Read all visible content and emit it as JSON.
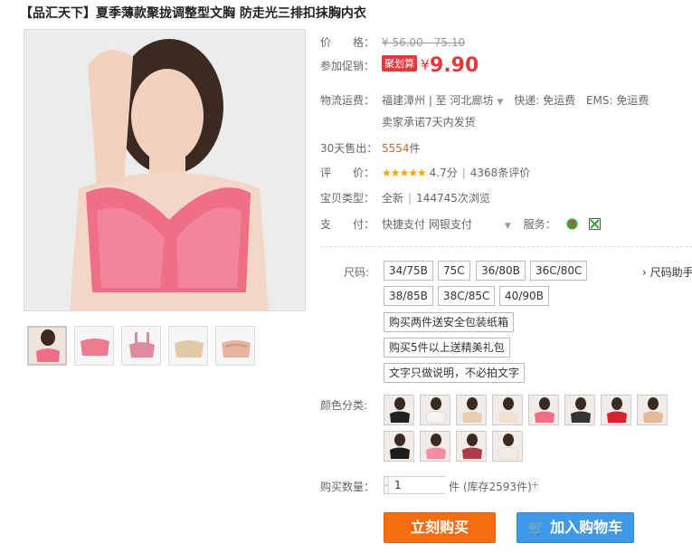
{
  "product": {
    "title": "【品汇天下】夏季薄款聚拢调整型文胸 防走光三排扣抹胸内衣"
  },
  "price": {
    "label": "价　　格：",
    "original": "¥ 56.00 - 75.10",
    "promo_label": "参加促销：",
    "promo_tag": "聚划算",
    "yen": "¥",
    "promo_price": "9.90"
  },
  "shipping": {
    "label": "物流运费：",
    "route": "福建漳州 | 至  河北廊坊",
    "express": "快递: 免运费",
    "ems": "EMS: 免运费",
    "promise": "卖家承诺7天内发货"
  },
  "sales": {
    "label": "30天售出：",
    "count": "5554",
    "unit": "件"
  },
  "rating": {
    "label": "评　　价：",
    "stars": "★★★★★",
    "score": "4.7分",
    "reviews": "4368条评价"
  },
  "info": {
    "label": "宝贝类型：",
    "condition": "全新",
    "views": "144745次浏览"
  },
  "payment": {
    "label": "支　　付：",
    "methods": "快捷支付  网银支付",
    "service_label": "服务："
  },
  "options": {
    "size_label": "尺码:",
    "sizes": [
      "34/75B",
      "75C",
      "36/80B",
      "36C/80C",
      "38/85B",
      "38C/85C",
      "40/90B"
    ],
    "size_help": "尺码助手",
    "notes": [
      "购买两件送安全包装纸箱",
      "购买5件以上送精美礼包",
      "文字只做说明，不必拍文字"
    ],
    "color_label": "颜色分类:",
    "color_count": 12
  },
  "quantity": {
    "label": "购买数量：",
    "value": "1",
    "stock": "件 (库存2593件)"
  },
  "buttons": {
    "buy": "立刻购买",
    "cart": "加入购物车"
  },
  "colors": {
    "promo": "#e4393c",
    "accent_orange": "#f66d10",
    "accent_blue": "#3f9ae8",
    "product_pink": "#ee6f87"
  }
}
